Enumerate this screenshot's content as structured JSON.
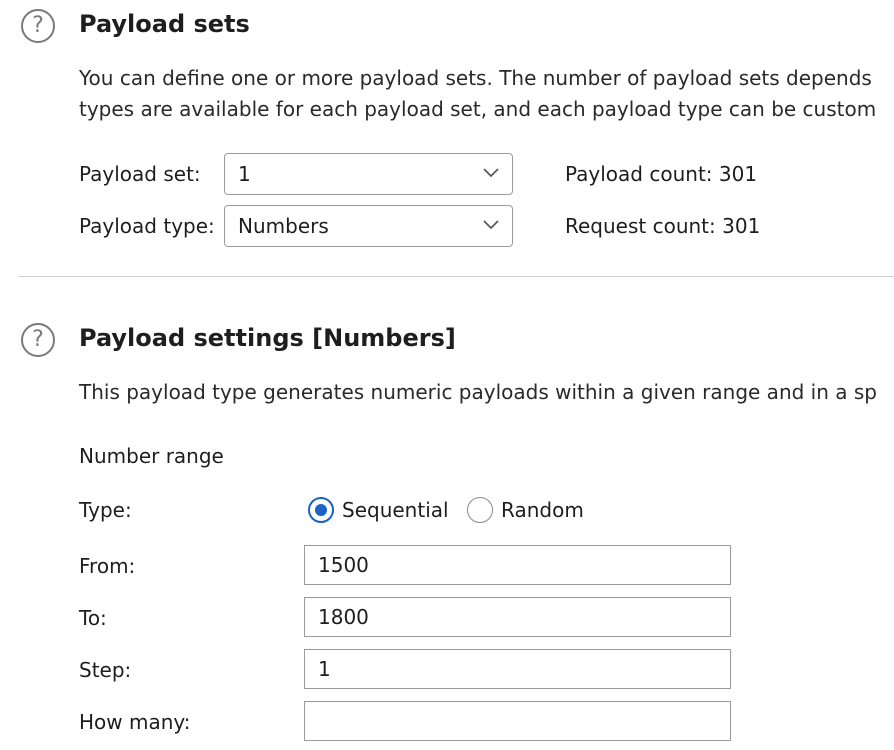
{
  "payload_sets": {
    "title": "Payload sets",
    "description_line1": "You can define one or more payload sets. The number of payload sets depends",
    "description_line2": "types are available for each payload set, and each payload type can be custom",
    "payload_set_label": "Payload set:",
    "payload_set_value": "1",
    "payload_type_label": "Payload type:",
    "payload_type_value": "Numbers",
    "payload_count": "Payload count: 301",
    "request_count": "Request count: 301"
  },
  "payload_settings": {
    "title": "Payload settings [Numbers]",
    "description": "This payload type generates numeric payloads within a given range and in a sp",
    "number_range_label": "Number range",
    "type_label": "Type:",
    "type_options": [
      "Sequential",
      "Random"
    ],
    "type_selected": "Sequential",
    "from_label": "From:",
    "from_value": "1500",
    "to_label": "To:",
    "to_value": "1800",
    "step_label": "Step:",
    "step_value": "1",
    "how_many_label": "How many:",
    "how_many_value": ""
  },
  "icons": {
    "help": "help-circle-icon",
    "dropdown": "chevron-down-icon"
  },
  "colors": {
    "accent": "#1a62c4",
    "text": "#1e1e1e",
    "border": "#9a9a9a",
    "icon": "#7a7a7a"
  }
}
